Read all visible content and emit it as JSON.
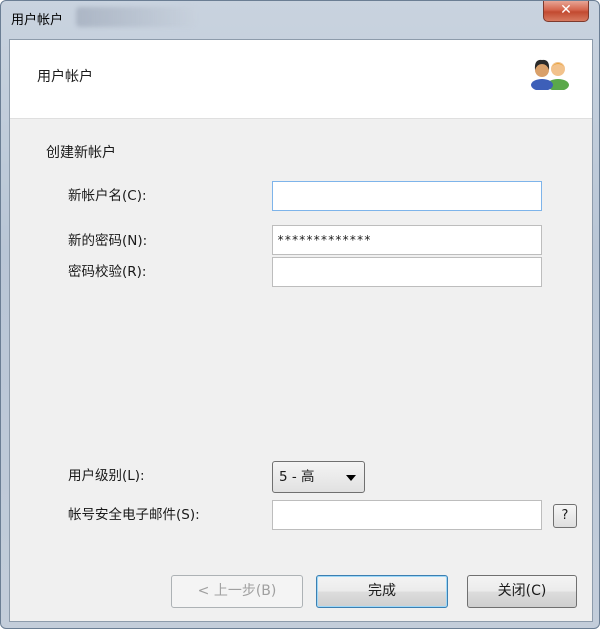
{
  "window": {
    "title": "用户帐户",
    "close_label": "✕"
  },
  "header": {
    "title": "用户帐户",
    "icon": "users-icon"
  },
  "form": {
    "section_title": "创建新帐户",
    "new_account_name": {
      "label": "新帐户名(C):",
      "value": ""
    },
    "new_password": {
      "label": "新的密码(N):",
      "value": "*************"
    },
    "confirm_password": {
      "label": "密码校验(R):",
      "value": ""
    },
    "user_level": {
      "label": "用户级别(L):",
      "selected": "5 - 高"
    },
    "security_email": {
      "label": "帐号安全电子邮件(S):",
      "value": "",
      "help_label": "?"
    }
  },
  "buttons": {
    "back": "< 上一步(B)",
    "finish": "完成",
    "close": "关闭(C)"
  },
  "colors": {
    "focus_border": "#7eb4ea",
    "default_button_border": "#3c7fb1"
  }
}
